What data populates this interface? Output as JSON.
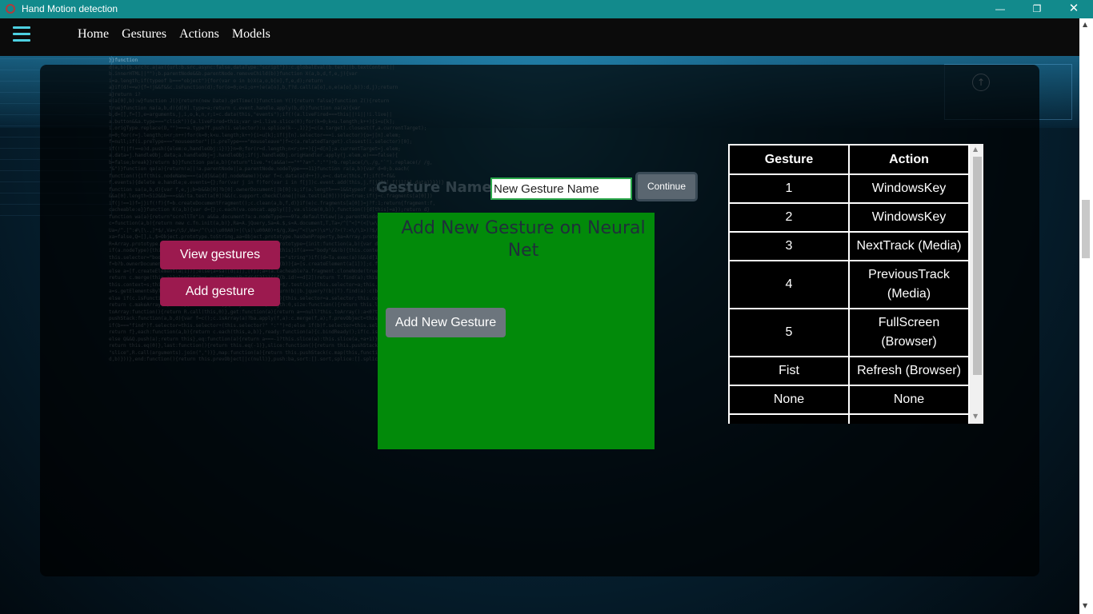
{
  "window": {
    "title": "Hand Motion detection",
    "minimize": "—",
    "maximize": "❐",
    "close": "✕"
  },
  "nav": {
    "items": [
      "Home",
      "Gestures",
      "Actions",
      "Models"
    ]
  },
  "sidebar": {
    "view_label": "View gestures",
    "add_label": "Add gesture"
  },
  "form": {
    "label": "Gesture Name:",
    "input_value": "New Gesture Name",
    "continue_label": "Continue"
  },
  "panel": {
    "title": "Add New Gesture on Neural Net",
    "button_label": "Add New Gesture"
  },
  "table": {
    "headers": [
      "Gesture",
      "Action"
    ],
    "rows": [
      [
        "1",
        "WindowsKey"
      ],
      [
        "2",
        "WindowsKey"
      ],
      [
        "3",
        "NextTrack (Media)"
      ],
      [
        "4",
        "PreviousTrack (Media)"
      ],
      [
        "5",
        "FullScreen (Browser)"
      ],
      [
        "Fist",
        "Refresh (Browser)"
      ],
      [
        "None",
        "None"
      ]
    ]
  },
  "background_code": "}}function\nd(a,b){b.src?c.ajax({url:b.src,async:false,dataType:\"script\"}):c.globalEval(b.text||b.textContent||\nb.innerHTML||\"\");b.parentNode&&b.parentNode.removeChild(b)}function X(a,b,d,f,e,j){var\ni=a.length;if(typeof b===\"object\"){for(var o in b)X(a,o,b[o],f,e,d);return\na}if(d!==w){f=!j&&f&&c.isFunction(d);for(o=0;o<i;o++)e(a[o],b,f?d.call(a[o],o,e(a[o],b)):d,j);return\na}return i?\ne(a[0],b):w}function J(){return(new Date).getTime()}function Y(){return false}function Z(){return\ntrue}function na(a,b,d){d[0].type=a;return c.event.handle.apply(b,d)}function oa(a){var\nb,d=[],f=[],e=arguments,j,i,o,k,n,r;i=c.data(this,\"events\");if(!(a.liveFired===this||!i||!i.live||\na.button&&a.type===\"click\")){a.liveFired=this;var u=i.live.slice(0);for(k=0;k<u.length;k++){i=u[k];\ni.origType.replace(O,\"\")===a.type?f.push(i.selector):u.splice(k--,1)}j=c(a.target).closest(f,a.currentTarget);\nn=0;for(r=j.length;n<r;n++)for(k=0;k<u.length;k++){i=u[k];if(j[n].selector===i.selector){o=j[n].elem;\nf=null;if(i.preType===\"mouseenter\"||i.preType===\"mouseleave\")f=c(a.relatedTarget).closest(i.selector)[0];\nif(!f||f!==o)d.push({elem:o,handleObj:i})}}n=0;for(r=d.length;n<r;n++){j=d[n];a.currentTarget=j.elem;\na.data=j.handleObj.data;a.handleObj=j.handleObj;if(j.handleObj.origHandler.apply(j.elem,e)===false){\nb=false;break}}return b}}function pa(a,b){return\"live.\"+(a&&a!==\"*\"?a+\".\":\"\")+b.replace(/\\./g,\"`\").replace(/ /g,\n\"&\")}function qa(a){return!a||!a.parentNode||a.parentNode.nodeType===11}function ra(a,b){var d=0;b.each(\nfunction(){if(this.nodeName===(a[d]&&a[d].nodeName)){var f=c.data(a[d++]),e=c.data(this,f);if(f=f&&\nf.events){delete e.handle;e.events={};for(var j in f)for(var i in f[j])c.event.add(this,j,f[j][i],f[j][i].data)}}})}\nfunction sa(a,b,d){var f,e,j;b=b&&b[0]?b[0].ownerDocument||b[0]:s;if(a.length===1&&typeof a[0]===\"string\"\n&&a[0].length<512&&b===s&&!ta.test(a[0])&&(c.support.checkClone||!ua.test(a[0]))){e=true;if(j=c.fragments[a[0]])\nif(j!==1)f=j}if(!f){f=b.createDocumentFragment();c.clean(a,b,f,d)}if(e)c.fragments[a[0]]=j?f:1;return{fragment:f,\ncacheable:e}}function K(a,b){var d={};c.each(va.concat.apply([],va.slice(0,b)),function(){d[this]=a});return d}\nfunction wa(a){return\"scrollTo\"in a&&a.document?a:a.nodeType===9?a.defaultView||a.parentWindow:false}var\nc=function(a,b){return new c.fn.init(a,b)},Ra=A.jQuery,Sa=A.$,s=A.document,T,Ta=/^[^<]*(<[\\w\\W]+>)[^>]*$|^#([\\w-]+)$/,\nUa=/^.[^:#\\[\\.,]*$/,Va=/\\S/,Wa=/^(\\s|\\u00A0)+|(\\s|\\u00A0)+$/g,Xa=/^<(\\w+)\\s*\\/?>(?:<\\/\\1>)?$/,P=navigator.userAgent,\nxa=false,Q=[],L,$=Object.prototype.toString,aa=Object.prototype.hasOwnProperty,ba=Array.prototype.push,\nR=Array.prototype.slice,ya=Array.prototype.indexOf;c.fn=c.prototype={init:function(a,b){var d,f;if(!a)return this;\nif(a.nodeType){this.context=this[0]=a;this.length=1;return this}if(a===\"body\"&&!b){this.context=s;this[0]=s.body;\nthis.selector=\"body\";this.length=1;return this}if(typeof a===\"string\")if((d=Ta.exec(a))&&(d[1]||!b))if(d[1]){\nf=b?b.ownerDocument||b:s;if(a=Xa.exec(a))if(c.isPlainObject(b)){a=[s.createElement(a[1])];c.fn.attr.call(a,b,true)}\nelse a=[f.createElement(a[1])];else{a=sa([d[1]],[f]);a=(a.cacheable?a.fragment.cloneNode(true):a.fragment).childNodes}\nreturn c.merge(this,a)}else{if(b=s.getElementById(d[2])){if(b.id!==d[2])return T.find(a);this.length=1;this[0]=b}\nthis.context=s;this.selector=a;return this}else if(!b&&/^\\w+$/.test(a)){this.selector=a;this.context=s;\na=s.getElementsByTagName(a);return c.merge(this,a)}else return!b||b.jquery?(b||T).find(a):c(b).find(a);\nelse if(c.isFunction(a))return T.ready(a);if(a.selector!==w){this.selector=a.selector;this.context=a.context}\nreturn c.makeArray(a,this)},selector:\"\",jquery:\"1.4.2\",length:0,size:function(){return this.length},\ntoArray:function(){return R.call(this,0)},get:function(a){return a==null?this.toArray():a<0?this.slice(a)[0]:this[a]},\npushStack:function(a,b,d){var f=c();c.isArray(a)?ba.apply(f,a):c.merge(f,a);f.prevObject=this;f.context=this.context;\nif(b===\"find\")f.selector=this.selector+(this.selector?\" \":\"\")+d;else if(b)f.selector=this.selector+\".\"+b+\"(\"+d+\")\";\nreturn f},each:function(a,b){return c.each(this,a,b)},ready:function(a){c.bindReady();if(c.isReady)a.call(s,c);\nelse Q&&Q.push(a);return this},eq:function(a){return a===-1?this.slice(a):this.slice(a,+a+1)},first:function(){\nreturn this.eq(0)},last:function(){return this.eq(-1)},slice:function(){return this.pushStack(R.apply(this,arguments),\n\"slice\",R.call(arguments).join(\",\"))},map:function(a){return this.pushStack(c.map(this,function(b,d){return a.call(b,\nd,b)}))},end:function(){return this.prevObject||c(null)},push:ba,sort:[].sort,splice:[].splice};"
}
